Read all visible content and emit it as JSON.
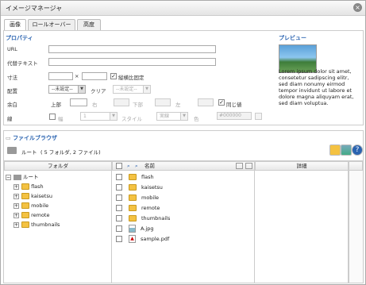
{
  "window": {
    "title": "イメージマネージャ"
  },
  "tabs": [
    {
      "label": "画像"
    },
    {
      "label": "ロールオーバー"
    },
    {
      "label": "高度"
    }
  ],
  "properties": {
    "heading": "プロパティ",
    "url_label": "URL",
    "alt_label": "代替テキスト",
    "size_label": "寸法",
    "size_x": "×",
    "keep_ratio_label": "縦横比固定",
    "align_label": "配置",
    "align_value": "--未設定--",
    "clear_label": "クリア",
    "clear_value": "--未設定--",
    "margin_label": "余白",
    "margin_top": "上部",
    "margin_right": "右",
    "margin_bottom": "下部",
    "margin_left": "左",
    "margin_same": "同じ値",
    "border_label": "線",
    "border_width": "幅",
    "border_width_value": "1",
    "border_style": "スタイル",
    "border_style_value": "実線",
    "border_color": "色",
    "border_color_value": "#000000"
  },
  "preview": {
    "heading": "プレビュー",
    "text": "Lorem ipsum dolor sit amet, consetetur sadipscing elitr, sed diam nonumy eirmod tempor invidunt ut labore et dolore magna aliquyam erat, sed diam voluptua."
  },
  "browser": {
    "heading": "ファイルブラウザ",
    "root_label": "ルート",
    "root_count": "( 5 フォルダ, 2 ファイル)",
    "col_folder": "フォルダ",
    "col_name": "名前",
    "col_detail": "詳細",
    "tree_root": "ルート",
    "tree": [
      "flash",
      "kaisetsu",
      "mobile",
      "remote",
      "thumbnails"
    ],
    "files": [
      {
        "name": "flash",
        "type": "folder"
      },
      {
        "name": "kaisetsu",
        "type": "folder"
      },
      {
        "name": "mobile",
        "type": "folder"
      },
      {
        "name": "remote",
        "type": "folder"
      },
      {
        "name": "thumbnails",
        "type": "folder"
      },
      {
        "name": "A.jpg",
        "type": "image"
      },
      {
        "name": "sample.pdf",
        "type": "pdf"
      }
    ]
  },
  "colors": {
    "accent": "#2a63b0",
    "folder": "#f4c242"
  }
}
